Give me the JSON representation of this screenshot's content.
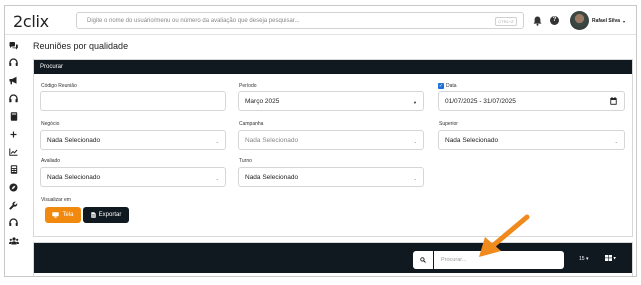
{
  "app": {
    "logo": "2clix"
  },
  "topbar": {
    "search_placeholder": "Digite o nome do usuário/menu ou número da avaliação que deseja pesquisar...",
    "shortcut": "CTRL+Z",
    "user_name": "Rafael Silva",
    "caret": "▾",
    "help": "?"
  },
  "sidebar": {
    "icons": [
      "chat-icon",
      "headset-icon",
      "megaphone-icon",
      "headphones-icon",
      "book-icon",
      "plus-icon",
      "chart-icon",
      "calculator-icon",
      "compass-icon",
      "wrench-icon",
      "headset-2-icon",
      "users-icon"
    ]
  },
  "page": {
    "title": "Reuniões por qualidade"
  },
  "filters": {
    "header": "Procurar",
    "codigo": {
      "label": "Código Reunião",
      "value": ""
    },
    "periodo": {
      "label": "Período",
      "value": "Março 2025"
    },
    "data": {
      "label": "Data",
      "checked": true,
      "value": "01/07/2025 - 31/07/2025"
    },
    "negocio": {
      "label": "Negócio",
      "value": "Nada Selecionado"
    },
    "campanha": {
      "label": "Campanha",
      "value": "Nada Selecionado"
    },
    "superior": {
      "label": "Superior",
      "value": "Nada Selecionado"
    },
    "avaliado": {
      "label": "Avaliado",
      "value": "Nada Selecionado"
    },
    "turno": {
      "label": "Turno",
      "value": "Nada Selecionado"
    },
    "visualizar": {
      "label": "Visualizar em",
      "tela": "Tela",
      "exportar": "Exportar"
    }
  },
  "table": {
    "search_placeholder": "Procurar...",
    "page_size": "15",
    "dropdown_caret": "▾"
  },
  "colors": {
    "accent": "#f2890f",
    "dark": "#101820",
    "checkbox": "#1e6fd9"
  }
}
